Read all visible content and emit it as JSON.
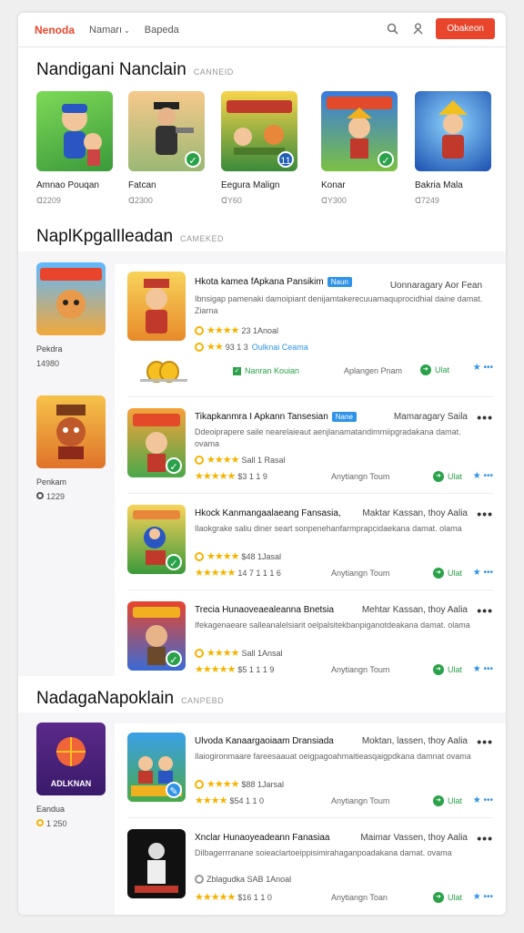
{
  "header": {
    "brand": "Nenoda",
    "nav1": "Namarı",
    "nav2": "Bapeda",
    "cta": "Obakeon"
  },
  "colors": {
    "accent": "#e8452c",
    "blue": "#2f93e8",
    "green": "#2aa24a",
    "star": "#f5b300"
  },
  "section1": {
    "title": "Nandigani Nanclain",
    "sub": "CANNEID",
    "items": [
      {
        "name": "Amnao Pouqan",
        "meta": "ᗡ2209"
      },
      {
        "name": "Fatcan",
        "meta": "ᗡ2300"
      },
      {
        "name": "Eegura Malign",
        "meta": "ᗡY60"
      },
      {
        "name": "Konar",
        "meta": "ᗡY300"
      },
      {
        "name": "Bakria Mala",
        "meta": "ᗡ7249"
      }
    ],
    "badge_text": "11"
  },
  "section2": {
    "title": "NaplKpgalIleadan",
    "sub": "CAMEKED",
    "side": [
      {
        "name": "Pekdra",
        "meta": "14980"
      },
      {
        "name": "Penkam",
        "meta": "1229"
      }
    ],
    "first_row": {
      "title": "Hkota kamea fApkana Pansikim",
      "tag": "Naun",
      "right_text": "Uonnaragary Aor Fean",
      "desc": "Ibnsigap pamenaki damoipiant denijamtakerecuuamaquprocidhial daine damat. Ziarna",
      "rating": "23",
      "rating_label": "1Anoal",
      "price_line": "93 1 3",
      "link": "Oulknai Ceama",
      "dev_label": "Nanran Kouian",
      "dev2": "Aplangen Pnam",
      "install": "Ulat"
    },
    "rows": [
      {
        "title": "Tikapkanmra I Apkann Tansesian",
        "tag": "Nane",
        "right_text": "Mamaragary Saila",
        "desc": "Ddeoiprapere saile nearelaieaut aenjlanamatandimmiipgradakana damat. ovama",
        "rating": "Sall",
        "rating_label": "1 Rasal",
        "price": "$3",
        "price2": "1 1 9",
        "dev": "Anytiangn Toum",
        "install": "Ulat"
      },
      {
        "title": "Hkock Kanmangaalaeang Fansasia,",
        "tag": "",
        "right_text": "Maktar Kassan, thoy Aalia",
        "desc": "Ilaokgrake saliu diner seart sonpenehanfarmprapcidaekana damat. olama",
        "rating": "$48",
        "rating_label": "1Jasal",
        "price": "14",
        "price2": "7 1 1 1 6",
        "dev": "Anytiangn Toum",
        "install": "Ulat"
      },
      {
        "title": "Trecia Hunaoveaealeanna Bnetsia",
        "tag": "",
        "right_text": "Mehtar Kassan, thoy Aalia",
        "desc": "Ifekagenaeare salleanalelsiarit oelpalsitekbanpiganotdeakana damat. olama",
        "rating": "Sall",
        "rating_label": "1Ansal",
        "price": "$5",
        "price2": "1 1 1 9",
        "dev": "Anytiangn Toum",
        "install": "Ulat"
      }
    ]
  },
  "section3": {
    "title": "NadagaNapoklain",
    "sub": "CANPEBD",
    "side": {
      "name": "Eandua",
      "meta": "1 250",
      "logo_text": "ADLKNAN"
    },
    "rows": [
      {
        "title": "Ulvoda Kanaargaoiaam Dransiada",
        "right_text": "Moktan, lassen, thoy Aalia",
        "desc": "Ilaiogironmaare fareesaauat oeigpagoahmaitieasqaigpdkana damnat ovama",
        "rating": "$88",
        "rating_label": "1Jarsal",
        "price": "$54",
        "price2": "1 1 0",
        "dev": "Anytiangn Toum",
        "install": "Ulat"
      },
      {
        "title": "Xnclar Hunaoyeadeann Fanasiaa",
        "right_text": "Maimar Vassen, thoy Aalia",
        "desc": "Dilbagerrranane soieaclartoeippisimirahaganpoadakana damat. ovama",
        "rating": "Zblagudka SAB",
        "rating_label": "1Anoal",
        "price": "$16",
        "price2": "1 1 0",
        "dev": "Anytiangn Toan",
        "install": "Ulat"
      }
    ]
  }
}
